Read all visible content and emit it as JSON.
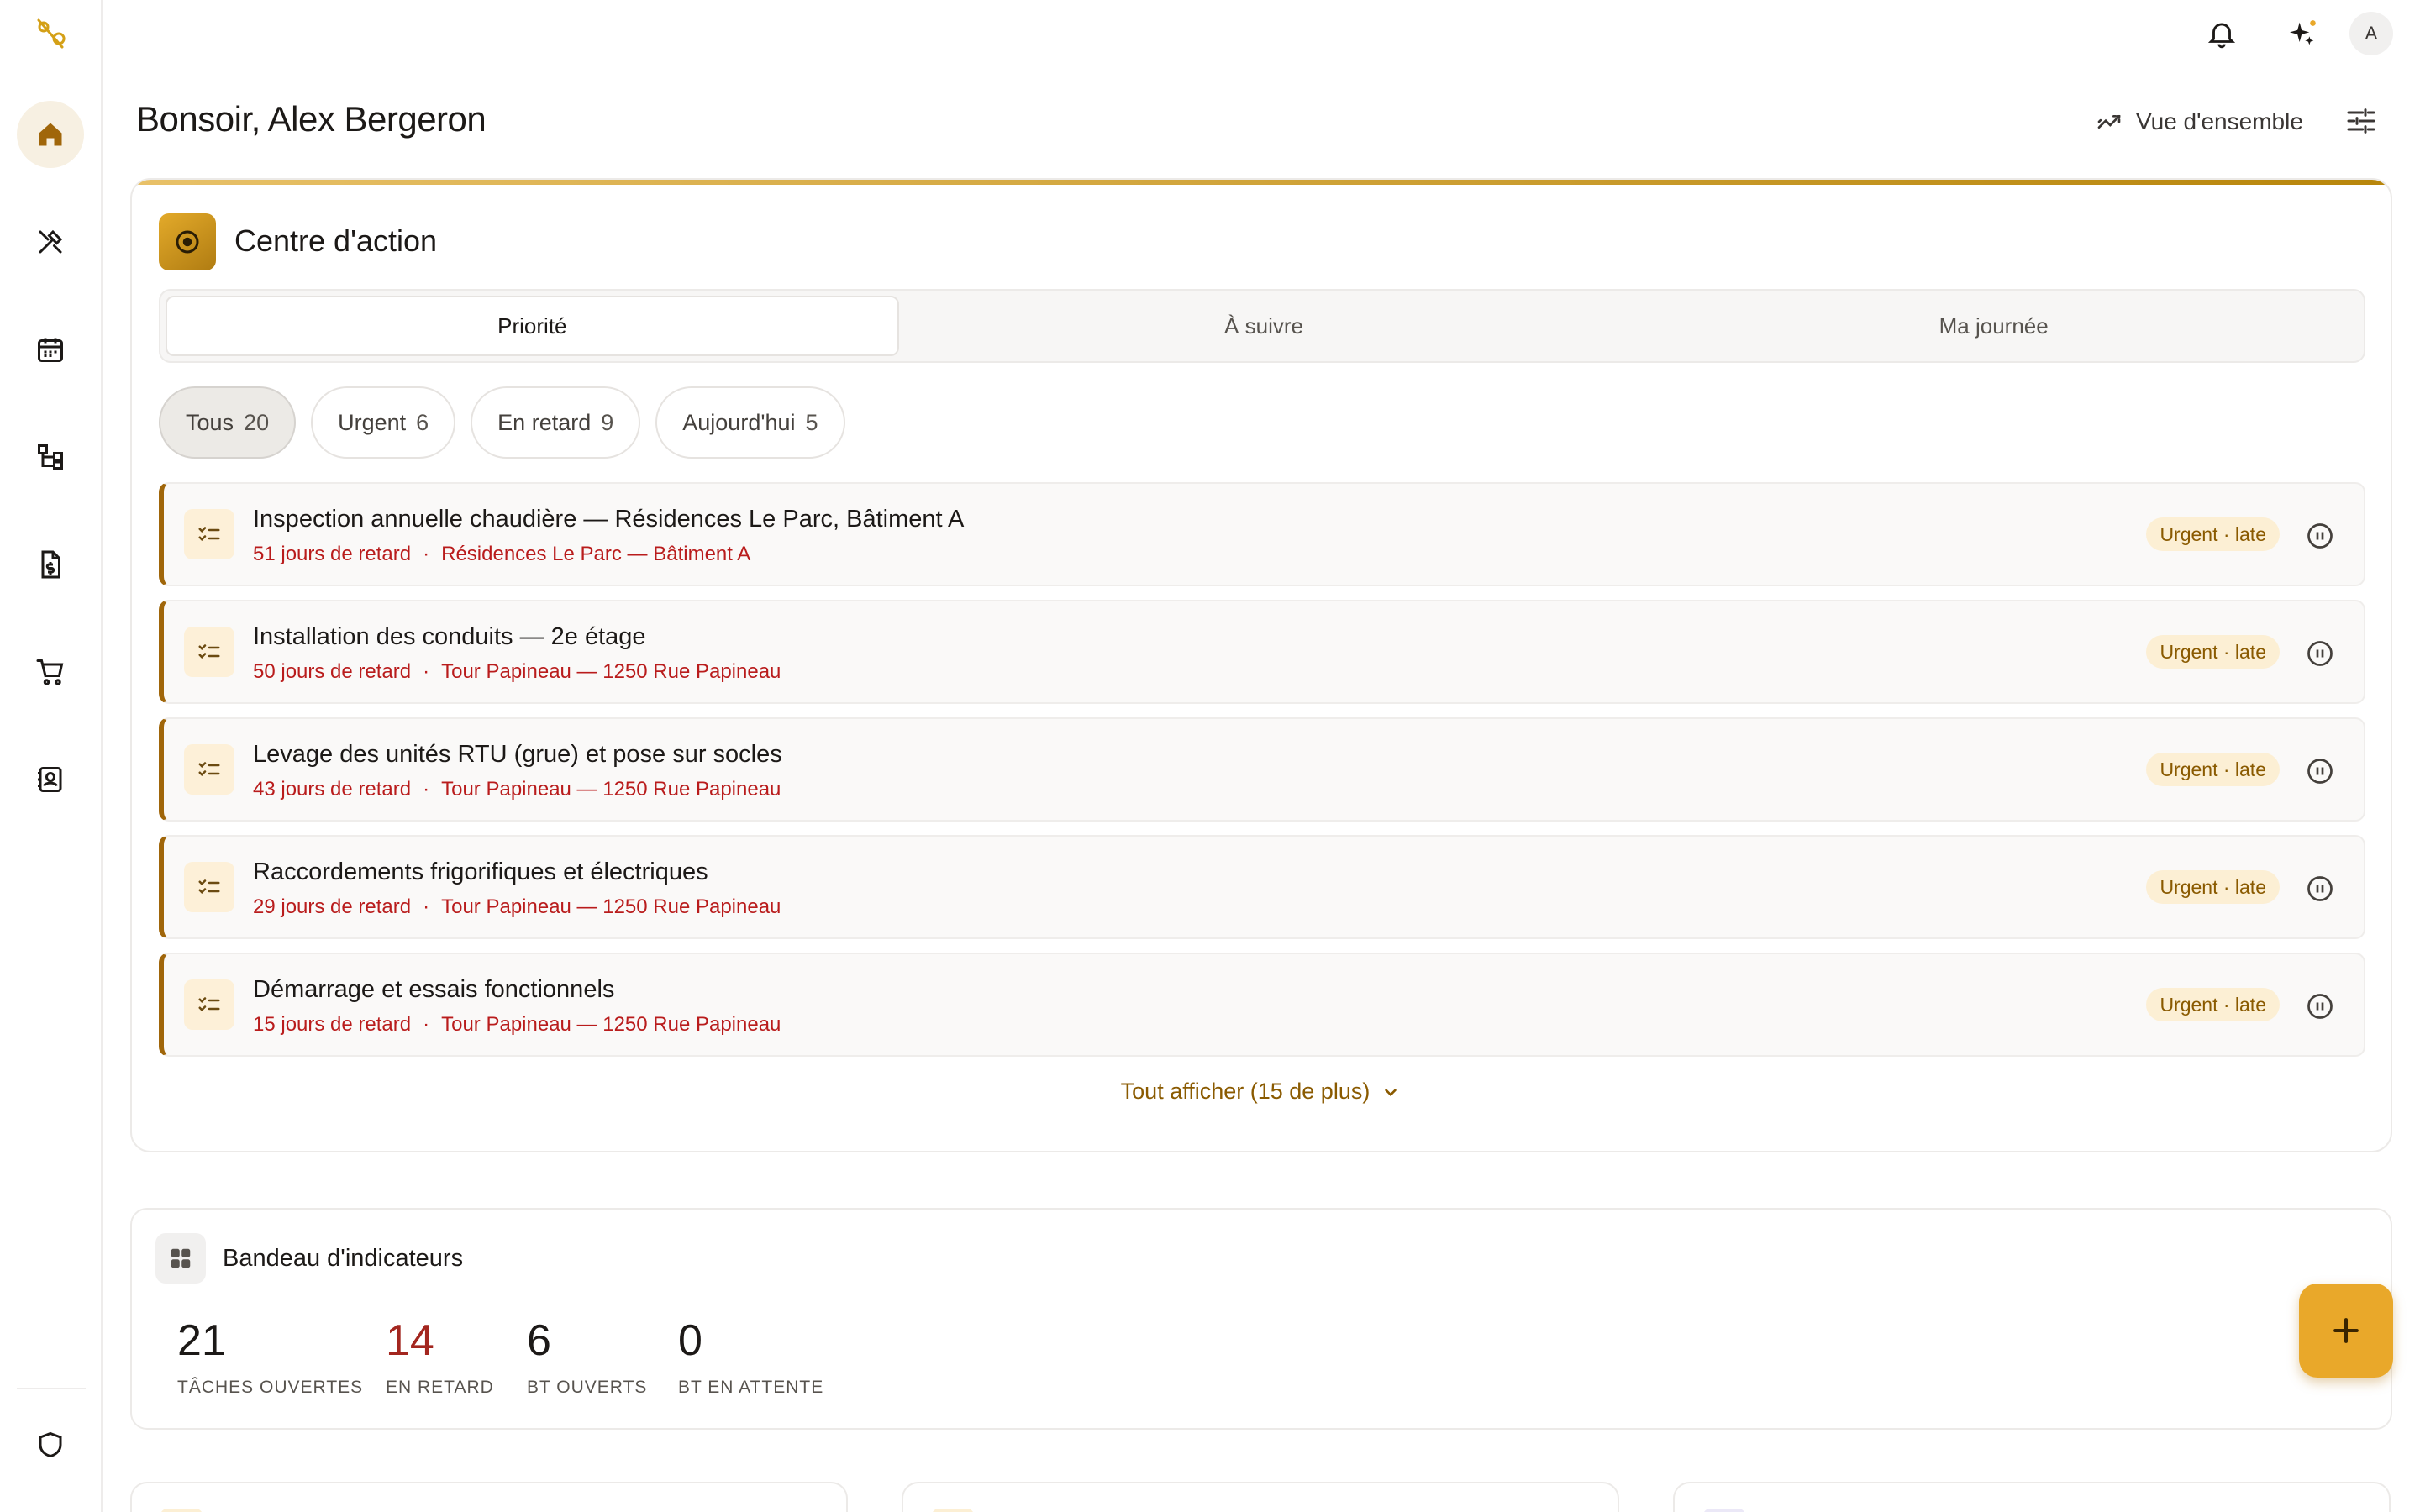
{
  "sidebar": {
    "logo": "lockup-logo-icon",
    "items": [
      {
        "icon": "home-icon",
        "active": true
      },
      {
        "icon": "tools-icon"
      },
      {
        "icon": "calendar-icon"
      },
      {
        "icon": "hierarchy-icon"
      },
      {
        "icon": "invoice-icon"
      },
      {
        "icon": "cart-icon"
      },
      {
        "icon": "contacts-icon"
      }
    ],
    "bottom_icon": "shield-icon"
  },
  "topbar": {
    "avatar_initial": "A"
  },
  "header": {
    "greeting": "Bonsoir, Alex Bergeron",
    "overview_label": "Vue d'ensemble"
  },
  "action_center": {
    "title": "Centre d'action",
    "tabs": [
      {
        "label": "Priorité",
        "active": true
      },
      {
        "label": "À suivre"
      },
      {
        "label": "Ma journée"
      }
    ],
    "filters": [
      {
        "label": "Tous",
        "count": "20",
        "active": true
      },
      {
        "label": "Urgent",
        "count": "6"
      },
      {
        "label": "En retard",
        "count": "9"
      },
      {
        "label": "Aujourd'hui",
        "count": "5"
      }
    ],
    "tasks": [
      {
        "title": "Inspection annuelle chaudière — Résidences Le Parc, Bâtiment A",
        "delay": "51 jours de retard",
        "location": "Résidences Le Parc — Bâtiment A",
        "badge": "Urgent · late"
      },
      {
        "title": "Installation des conduits — 2e étage",
        "delay": "50 jours de retard",
        "location": "Tour Papineau — 1250 Rue Papineau",
        "badge": "Urgent · late"
      },
      {
        "title": "Levage des unités RTU (grue) et pose sur socles",
        "delay": "43 jours de retard",
        "location": "Tour Papineau — 1250 Rue Papineau",
        "badge": "Urgent · late"
      },
      {
        "title": "Raccordements frigorifiques et électriques",
        "delay": "29 jours de retard",
        "location": "Tour Papineau — 1250 Rue Papineau",
        "badge": "Urgent · late"
      },
      {
        "title": "Démarrage et essais fonctionnels",
        "delay": "15 jours de retard",
        "location": "Tour Papineau — 1250 Rue Papineau",
        "badge": "Urgent · late"
      }
    ],
    "separator": "·",
    "show_all": "Tout afficher (15 de plus)"
  },
  "kpis": {
    "title": "Bandeau d'indicateurs",
    "items": [
      {
        "value": "21",
        "label": "TÂCHES OUVERTES"
      },
      {
        "value": "14",
        "label": "EN RETARD",
        "alert": true
      },
      {
        "value": "6",
        "label": "BT OUVERTS"
      },
      {
        "value": "0",
        "label": "BT EN ATTENTE"
      }
    ]
  },
  "colors": {
    "accent": "#d4a017",
    "accent_dark": "#a0660a",
    "late_red": "#b91c1c",
    "fab": "#e9a82a"
  }
}
